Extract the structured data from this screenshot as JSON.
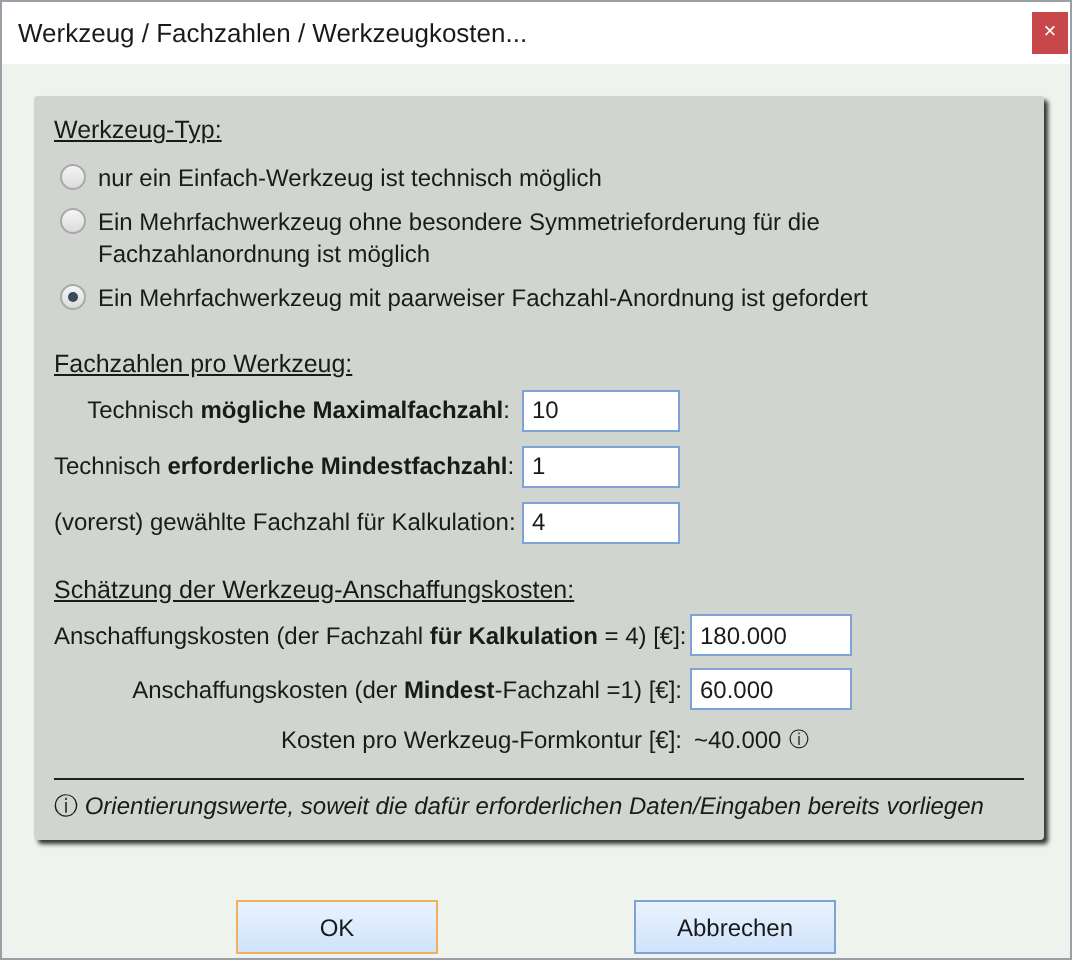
{
  "window": {
    "title": "Werkzeug / Fachzahlen / Werkzeugkosten...",
    "close": "×"
  },
  "tool_type": {
    "heading": "Werkzeug-Typ:",
    "options": [
      {
        "label": "nur ein Einfach-Werkzeug ist technisch möglich",
        "selected": false
      },
      {
        "label": "Ein Mehrfachwerkzeug ohne besondere Symmetrieforderung für die Fachzahlanordnung ist möglich",
        "selected": false
      },
      {
        "label": "Ein Mehrfachwerkzeug mit paarweiser Fachzahl-Anordnung ist gefordert",
        "selected": true
      }
    ]
  },
  "cavities": {
    "heading": "Fachzahlen pro Werkzeug:",
    "fields": [
      {
        "label": "Technisch **mögliche Maximalfachzahl**:",
        "value": "10"
      },
      {
        "label": "Technisch **erforderliche Mindestfachzahl**:",
        "value": "1"
      },
      {
        "label": "(vorerst) gewählte Fachzahl für Kalkulation:",
        "value": "4"
      }
    ]
  },
  "costs": {
    "heading": "Schätzung der Werkzeug-Anschaffungskosten:",
    "rows": [
      {
        "kind": "field",
        "label": "Anschaffungskosten (der Fachzahl **für Kalkulation** = 4) [€]:",
        "value": "180.000"
      },
      {
        "kind": "field",
        "label": "Anschaffungskosten (der **Mindest**-Fachzahl =1) [€]:",
        "value": "60.000"
      },
      {
        "kind": "reading",
        "label": "Kosten pro Werkzeug-Formkontur [€]:",
        "value": "~40.000",
        "marker": "ⓘ"
      }
    ]
  },
  "note": "ⓘ *Orientierungswerte, soweit die dafür erforderlichen Daten/Eingaben bereits vorliegen*",
  "buttons": [
    {
      "label": "OK",
      "default": true
    },
    {
      "label": "Abbrechen",
      "default": false
    }
  ]
}
